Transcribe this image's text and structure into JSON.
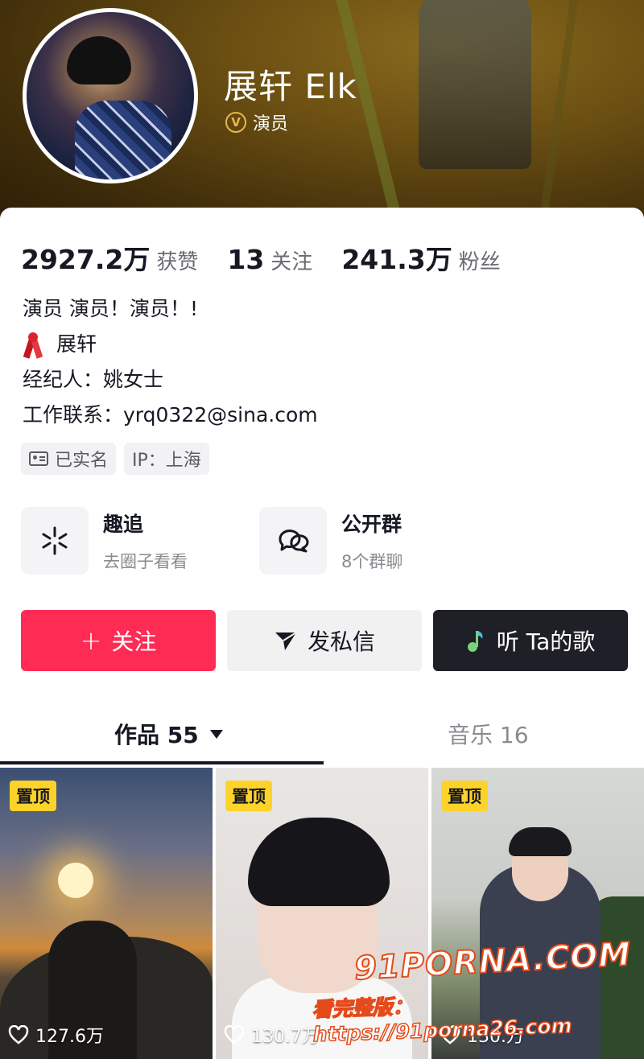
{
  "profile": {
    "name": "展轩 Elk",
    "verified_label": "演员",
    "verified_icon_text": "V"
  },
  "stats": [
    {
      "value": "2927.2万",
      "label": "获赞"
    },
    {
      "value": "13",
      "label": "关注"
    },
    {
      "value": "241.3万",
      "label": "粉丝"
    }
  ],
  "bio": {
    "line1": "演员 演员！演员！!",
    "line2": "展轩",
    "line3": "经纪人：姚女士",
    "line4": "工作联系：yrq0322@sina.com"
  },
  "tags": [
    {
      "icon": "id-card-icon",
      "label": "已实名"
    },
    {
      "icon": "",
      "label": "IP：上海"
    }
  ],
  "features": [
    {
      "icon": "sparkle-icon",
      "title": "趣追",
      "subtitle": "去圈子看看"
    },
    {
      "icon": "chat-bubbles-icon",
      "title": "公开群",
      "subtitle": "8个群聊"
    }
  ],
  "actions": {
    "follow": "关注",
    "follow_icon": "+",
    "message": "发私信",
    "music": "听 Ta的歌"
  },
  "tabs": {
    "works": "作品 55",
    "music": "音乐 16"
  },
  "videos": [
    {
      "pinned": "置顶",
      "likes": "127.6万"
    },
    {
      "pinned": "置顶",
      "likes": "130.7万"
    },
    {
      "pinned": "置顶",
      "likes": "130.万"
    }
  ],
  "watermark": {
    "brand": "91PORNA.COM",
    "text": "看完整版：https://91porna26.com"
  },
  "colors": {
    "follow_button": "#fe2c55",
    "music_button": "#1f1f27",
    "pin_badge": "#fdd32a",
    "verify_badge": "#e8b74a"
  }
}
